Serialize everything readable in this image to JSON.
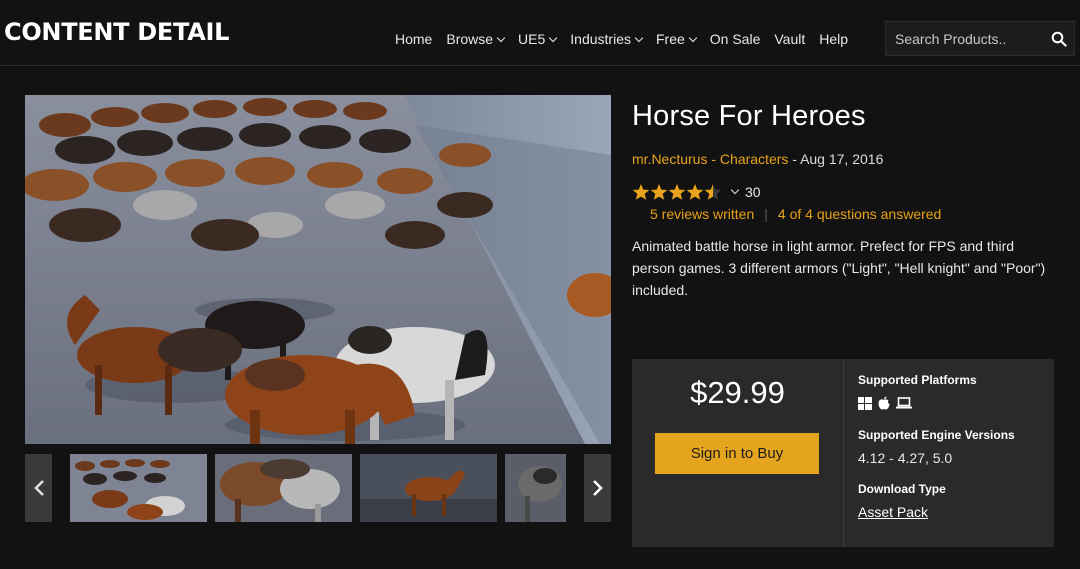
{
  "header": {
    "logo": "CONTENT DETAIL",
    "nav": [
      {
        "label": "Home",
        "dropdown": false
      },
      {
        "label": "Browse",
        "dropdown": true
      },
      {
        "label": "UE5",
        "dropdown": true
      },
      {
        "label": "Industries",
        "dropdown": true
      },
      {
        "label": "Free",
        "dropdown": true
      },
      {
        "label": "On Sale",
        "dropdown": false
      },
      {
        "label": "Vault",
        "dropdown": false
      },
      {
        "label": "Help",
        "dropdown": false
      }
    ],
    "search_placeholder": "Search Products..",
    "search_icon": "search-icon"
  },
  "product": {
    "title": "Horse For Heroes",
    "seller": "mr.Necturus",
    "category": "Characters",
    "date": "Aug 17, 2016",
    "meta_sep": " - ",
    "rating_value": 4.5,
    "rating_max": 5,
    "rating_count": "30",
    "reviews_written": "5 reviews written",
    "questions_answered": "4 of 4 questions answered",
    "reviews_sep": "|",
    "description": "Animated battle horse in light armor. Prefect for FPS and third person games. 3 different armors (\"Light\", \"Hell knight\" and \"Poor\") included."
  },
  "gallery": {
    "main_caption": "",
    "thumbnails": [
      "thumb-1",
      "thumb-2",
      "thumb-3",
      "thumb-4"
    ],
    "prev_icon": "chevron-left-icon",
    "next_icon": "chevron-right-icon"
  },
  "buy": {
    "price": "$29.99",
    "button_label": "Sign in to Buy",
    "platforms_heading": "Supported Platforms",
    "platforms": [
      "windows-icon",
      "apple-icon",
      "laptop-icon"
    ],
    "engine_heading": "Supported Engine Versions",
    "engine_versions": "4.12 - 4.27, 5.0",
    "download_heading": "Download Type",
    "download_type": "Asset Pack"
  },
  "colors": {
    "accent": "#e8a21b",
    "button": "#e5a41d",
    "background": "#121212",
    "panel": "#2a2a2a"
  }
}
